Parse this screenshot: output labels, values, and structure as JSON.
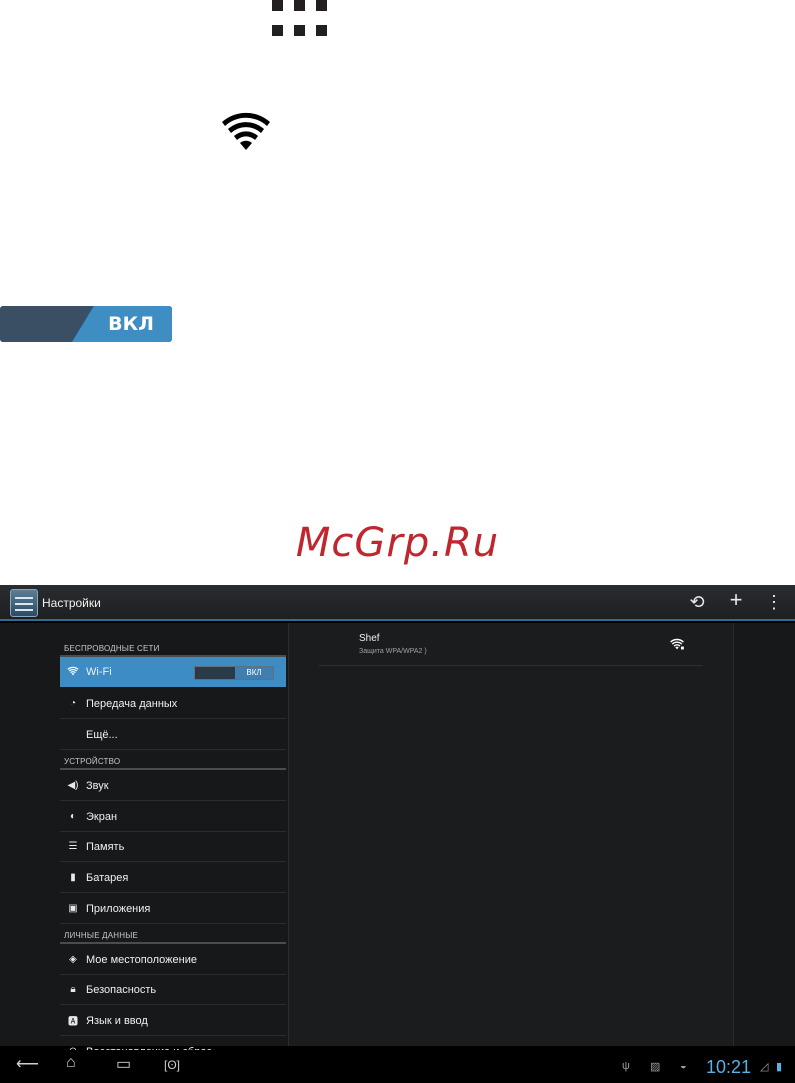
{
  "manual": {
    "toggle_label": "ВКЛ",
    "watermark": "McGrp.Ru",
    "icons": [
      "apps-grid-icon",
      "wifi-icon"
    ]
  },
  "screen": {
    "app_title": "Настройки",
    "actions": [
      "sync-icon",
      "add-icon",
      "overflow-menu-icon"
    ],
    "sections": [
      {
        "header": "БЕСПРОВОДНЫЕ СЕТИ",
        "items": [
          {
            "label": "Wi-Fi",
            "icon": "wifi-icon",
            "selected": true,
            "toggle": "ВКЛ"
          },
          {
            "label": "Передача данных",
            "icon": "data-usage-icon"
          },
          {
            "label": "Ещё...",
            "icon": ""
          }
        ]
      },
      {
        "header": "УСТРОЙСТВО",
        "items": [
          {
            "label": "Звук",
            "icon": "speaker-icon"
          },
          {
            "label": "Экран",
            "icon": "brightness-icon"
          },
          {
            "label": "Память",
            "icon": "storage-icon"
          },
          {
            "label": "Батарея",
            "icon": "battery-icon"
          },
          {
            "label": "Приложения",
            "icon": "apps-icon"
          }
        ]
      },
      {
        "header": "ЛИЧНЫЕ ДАННЫЕ",
        "items": [
          {
            "label": "Мое местоположение",
            "icon": "location-icon"
          },
          {
            "label": "Безопасность",
            "icon": "lock-icon"
          },
          {
            "label": "Язык и ввод",
            "icon": "keyboard-icon"
          },
          {
            "label": "Восстановление и сброс",
            "icon": "backup-icon"
          }
        ]
      }
    ],
    "network": {
      "name": "Shef",
      "status": "Защита WPA/WPA2 )",
      "icon": "wifi-signal-locked-icon"
    },
    "navbar": {
      "buttons": [
        "back-icon",
        "home-icon",
        "recent-apps-icon",
        "screenshot-icon"
      ],
      "clock": "10:21",
      "status_icons": [
        "usb-icon",
        "image-icon",
        "android-icon",
        "signal-icon",
        "battery-charging-icon"
      ]
    },
    "colors": {
      "accent": "#3d8cc4",
      "clock": "#5ab0e5",
      "watermark": "#c0262d"
    }
  }
}
